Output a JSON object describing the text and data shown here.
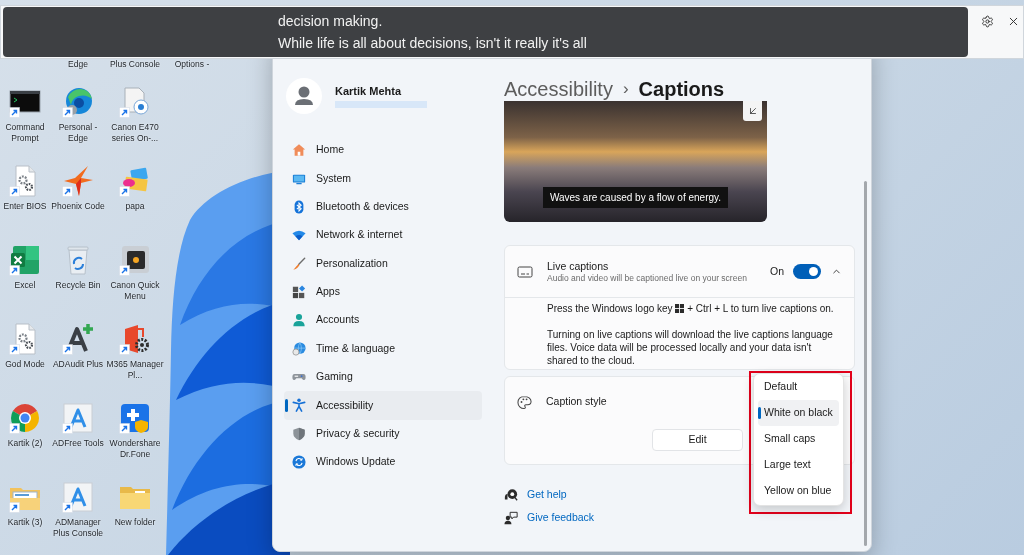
{
  "caption_window": {
    "lines": [
      "decision making.",
      "While life is all about decisions, isn't it really it's all"
    ]
  },
  "desktop": {
    "partial_labels": [
      "Edge",
      "Plus Console",
      "Options -"
    ],
    "icons": [
      "Command Prompt",
      "Personal - Edge",
      "Canon E470 series On-...",
      "Enter BIOS",
      "Phoenix Code",
      "papa",
      "Excel",
      "Recycle Bin",
      "Canon Quick Menu",
      "God Mode",
      "ADAudit Plus",
      "M365 Manager Pl...",
      "Kartik (2)",
      "ADFree Tools",
      "Wondershare Dr.Fone",
      "Kartik (3)",
      "ADManager Plus Console",
      "New folder"
    ]
  },
  "settings": {
    "user": {
      "name": "Kartik Mehta"
    },
    "nav": [
      {
        "label": "Home",
        "selected": false
      },
      {
        "label": "System",
        "selected": false
      },
      {
        "label": "Bluetooth & devices",
        "selected": false
      },
      {
        "label": "Network & internet",
        "selected": false
      },
      {
        "label": "Personalization",
        "selected": false
      },
      {
        "label": "Apps",
        "selected": false
      },
      {
        "label": "Accounts",
        "selected": false
      },
      {
        "label": "Time & language",
        "selected": false
      },
      {
        "label": "Gaming",
        "selected": false
      },
      {
        "label": "Accessibility",
        "selected": true
      },
      {
        "label": "Privacy & security",
        "selected": false
      },
      {
        "label": "Windows Update",
        "selected": false
      }
    ],
    "breadcrumb": {
      "parent": "Accessibility",
      "separator": "›",
      "current": "Captions"
    },
    "preview": {
      "caption": "Waves are caused by a flow of energy."
    },
    "live_captions": {
      "title": "Live captions",
      "description": "Audio and video will be captioned live on your screen",
      "state_label": "On",
      "on": true,
      "expanded": true,
      "shortcut_before": "Press the Windows logo key",
      "shortcut_after": "+ Ctrl + L to turn live captions on.",
      "note": "Turning on live captions will download the live captions language files. Voice data will be processed locally and your data isn't shared to the cloud."
    },
    "caption_style": {
      "title": "Caption style",
      "button": "Edit",
      "options": [
        {
          "label": "Default",
          "selected": false
        },
        {
          "label": "White on black",
          "selected": true
        },
        {
          "label": "Small caps",
          "selected": false
        },
        {
          "label": "Large text",
          "selected": false
        },
        {
          "label": "Yellow on blue",
          "selected": false
        }
      ]
    },
    "links": [
      "Get help",
      "Give feedback"
    ]
  }
}
